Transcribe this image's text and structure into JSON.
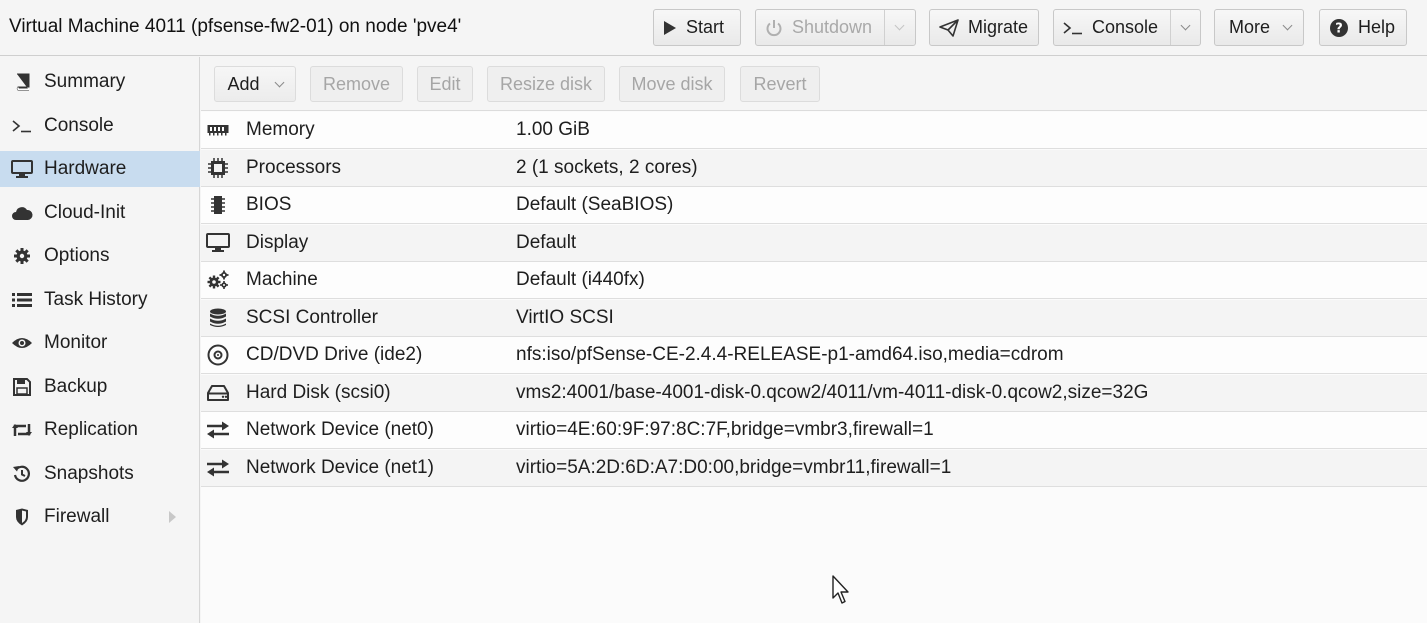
{
  "header": {
    "title": "Virtual Machine 4011 (pfsense-fw2-01) on node 'pve4'",
    "buttons": {
      "start": "Start",
      "shutdown": "Shutdown",
      "migrate": "Migrate",
      "console": "Console",
      "more": "More",
      "help": "Help"
    }
  },
  "sidebar": {
    "items": [
      {
        "label": "Summary",
        "icon": "book-icon"
      },
      {
        "label": "Console",
        "icon": "terminal-icon"
      },
      {
        "label": "Hardware",
        "icon": "desktop-icon",
        "active": true
      },
      {
        "label": "Cloud-Init",
        "icon": "cloud-icon"
      },
      {
        "label": "Options",
        "icon": "gear-icon"
      },
      {
        "label": "Task History",
        "icon": "list-icon"
      },
      {
        "label": "Monitor",
        "icon": "eye-icon"
      },
      {
        "label": "Backup",
        "icon": "floppy-icon"
      },
      {
        "label": "Replication",
        "icon": "retweet-icon"
      },
      {
        "label": "Snapshots",
        "icon": "history-icon"
      },
      {
        "label": "Firewall",
        "icon": "shield-icon"
      }
    ]
  },
  "toolbar": {
    "add": "Add",
    "remove": "Remove",
    "edit": "Edit",
    "resize_disk": "Resize disk",
    "move_disk": "Move disk",
    "revert": "Revert"
  },
  "hardware": {
    "rows": [
      {
        "name": "Memory",
        "value": "1.00 GiB",
        "icon": "memory-icon"
      },
      {
        "name": "Processors",
        "value": "2 (1 sockets, 2 cores)",
        "icon": "cpu-icon"
      },
      {
        "name": "BIOS",
        "value": "Default (SeaBIOS)",
        "icon": "microchip-icon"
      },
      {
        "name": "Display",
        "value": "Default",
        "icon": "desktop-icon"
      },
      {
        "name": "Machine",
        "value": "Default (i440fx)",
        "icon": "cogs-icon"
      },
      {
        "name": "SCSI Controller",
        "value": "VirtIO SCSI",
        "icon": "database-icon"
      },
      {
        "name": "CD/DVD Drive (ide2)",
        "value": "nfs:iso/pfSense-CE-2.4.4-RELEASE-p1-amd64.iso,media=cdrom",
        "icon": "cdrom-icon"
      },
      {
        "name": "Hard Disk (scsi0)",
        "value": "vms2:4001/base-4001-disk-0.qcow2/4011/vm-4011-disk-0.qcow2,size=32G",
        "icon": "hdd-icon"
      },
      {
        "name": "Network Device (net0)",
        "value": "virtio=4E:60:9F:97:8C:7F,bridge=vmbr3,firewall=1",
        "icon": "exchange-icon"
      },
      {
        "name": "Network Device (net1)",
        "value": "virtio=5A:2D:6D:A7:D0:00,bridge=vmbr11,firewall=1",
        "icon": "exchange-icon"
      }
    ]
  },
  "colors": {
    "active_nav": "#c8dcef",
    "disabled_text": "#a6a6a6"
  }
}
